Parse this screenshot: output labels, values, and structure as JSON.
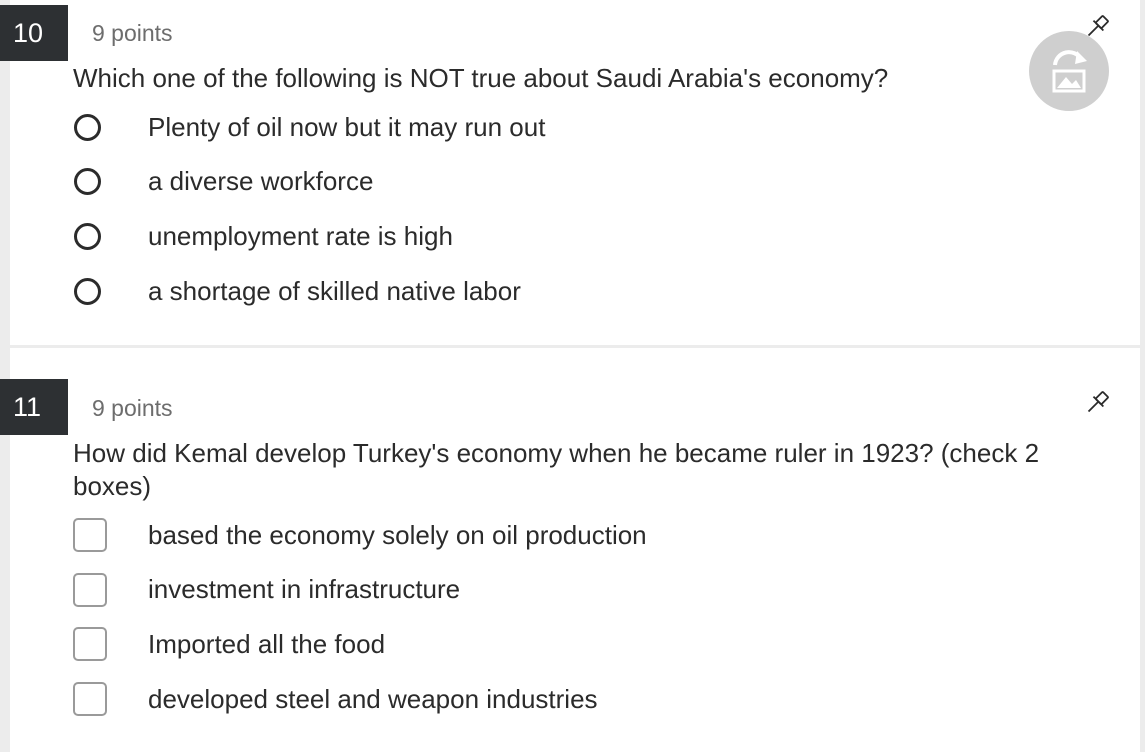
{
  "questions": [
    {
      "number": "10",
      "points": "9 points",
      "text": "Which one of the following is NOT true about Saudi Arabia's economy?",
      "input_type": "radio",
      "options": [
        "Plenty of oil now but it may run out",
        "a diverse workforce",
        "unemployment rate is high",
        "a shortage of skilled native labor"
      ]
    },
    {
      "number": "11",
      "points": "9 points",
      "text": "How did Kemal develop Turkey's economy when he became ruler in 1923? (check 2 boxes)",
      "input_type": "checkbox",
      "options": [
        "based the economy solely on oil production",
        "investment in infrastructure",
        "Imported all the food",
        "developed steel and weapon industries"
      ]
    }
  ],
  "icons": {
    "pin": "pin-icon",
    "floating_button": "image-refresh-icon"
  },
  "colors": {
    "page_background": "#ececec",
    "card_background": "#ffffff",
    "question_number_badge": "#2d3033",
    "points_text": "#6d6d6d",
    "floating_button": "#cfcfcf"
  }
}
